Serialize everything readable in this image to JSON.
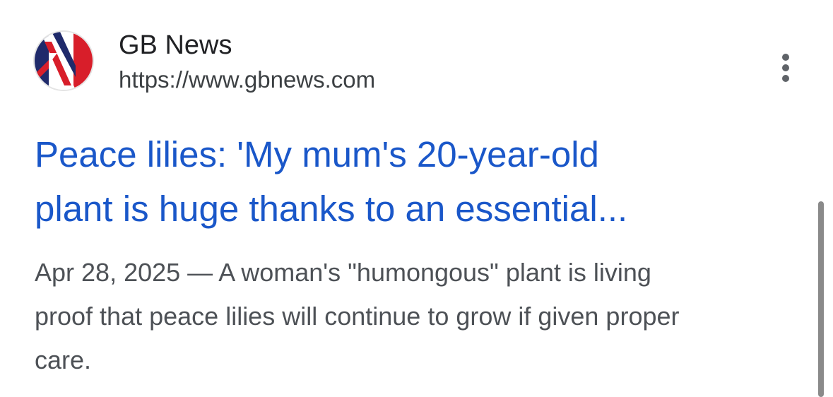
{
  "source": {
    "name": "GB News",
    "url": "https://www.gbnews.com",
    "favicon_icon": "union-jack-logo"
  },
  "result": {
    "title_lines": [
      "Peace lilies: 'My mum's 20-year-old",
      "plant is huge thanks to an essential..."
    ],
    "date": "Apr 28, 2025",
    "separator": "—",
    "snippet_lines": [
      "A woman's \"humongous\" plant is living",
      "proof that peace lilies will continue to grow if given proper",
      "care."
    ]
  },
  "menu": {
    "icon": "more-vert-icon"
  },
  "colors": {
    "link": "#1a57c9",
    "site_name": "#202124",
    "url": "#3c4043",
    "snippet": "#4d5156",
    "scrollbar": "#8a8a8a"
  }
}
